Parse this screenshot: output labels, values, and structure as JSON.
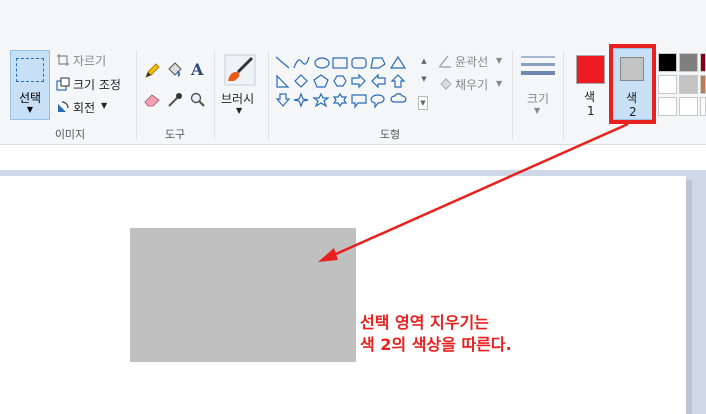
{
  "image_group": {
    "label": "이미지",
    "select_label": "선택",
    "crop_label": "자르기",
    "resize_label": "크기 조정",
    "rotate_label": "회전"
  },
  "tools_group": {
    "label": "도구",
    "text_tool_glyph": "A"
  },
  "brushes": {
    "label": "브러시"
  },
  "shapes_group": {
    "label": "도형",
    "outline_label": "윤곽선",
    "fill_label": "채우기"
  },
  "size": {
    "label": "크기"
  },
  "color1": {
    "label_line1": "색",
    "label_line2": "1",
    "color": "#ed1c24"
  },
  "color2": {
    "label_line1": "색",
    "label_line2": "2",
    "color": "#c3c3c3"
  },
  "palette": {
    "row1": [
      "#000000",
      "#7f7f7f",
      "#880015"
    ],
    "row2": [
      "#ffffff",
      "#c3c3c3",
      "#b97a57"
    ],
    "row3": [
      "#ffffff",
      "#ffffff",
      "#ffffff"
    ]
  },
  "canvas": {
    "erased_region_color": "#c0c0c0",
    "annotation_line1": "선택 영역 지우기는",
    "annotation_line2": "색 2의 색상을 따른다.",
    "annotation_color": "#e8211f"
  }
}
